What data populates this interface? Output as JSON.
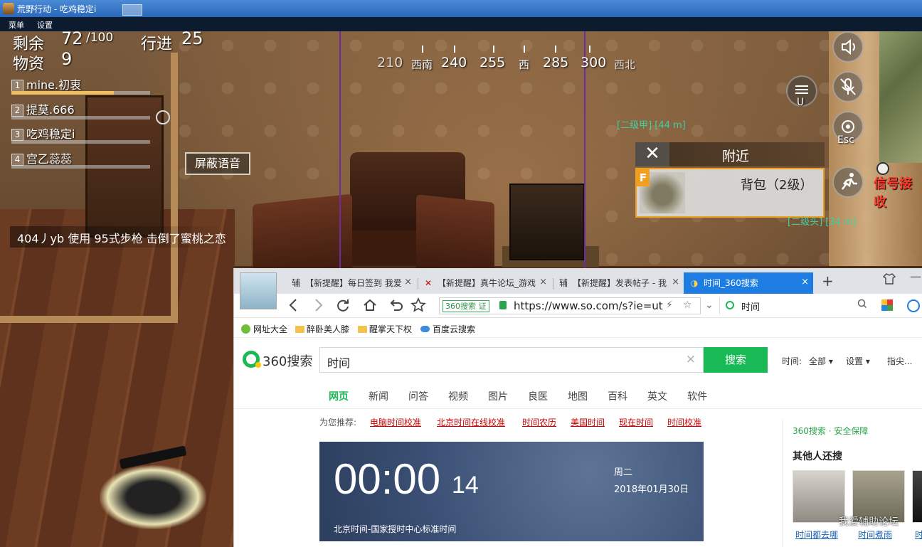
{
  "window": {
    "title": "荒野行动 - 吃鸡稳定i"
  },
  "menubar": {
    "items": [
      "菜单",
      "设置"
    ]
  },
  "hud": {
    "remaining_label": "剩余",
    "remaining_value": "72",
    "remaining_total": "/100",
    "travel_label": "行进",
    "travel_value": "25",
    "supplies_label": "物资",
    "supplies_value": "9",
    "team": [
      {
        "num": "1",
        "name": "mine.初衷",
        "hp": 0.74
      },
      {
        "num": "2",
        "name": "提莫.666",
        "hp": 0
      },
      {
        "num": "3",
        "name": "吃鸡稳定i",
        "hp": 0
      },
      {
        "num": "4",
        "name": "宫乙蕊蕊",
        "hp": 0
      }
    ],
    "mute_voice": "屏蔽语音",
    "kill_feed": "404丿yb 使用 95式步枪 击倒了蜜桃之恋"
  },
  "compass": [
    "210",
    "西南",
    "240",
    "255",
    "西",
    "285",
    "300",
    "西北"
  ],
  "controls": {
    "u_label": "U",
    "esc_label": "Esc"
  },
  "nearby": {
    "dist_top": "[二级甲] [44 m]",
    "dist_bottom": "[二级头] [34 m]",
    "title": "附近",
    "close": "✕",
    "item_key": "F",
    "item_name": "背包（2级）",
    "signal_text": "信号接收"
  },
  "browser": {
    "tabs": [
      {
        "fav": "辅",
        "title": "【新提醒】每日签到 我爱"
      },
      {
        "fav": "✕",
        "title": "【新提醒】真牛论坛_游戏"
      },
      {
        "fav": "辅",
        "title": "【新提醒】发表帖子 - 我"
      },
      {
        "fav": "◑",
        "title": "时间_360搜索"
      }
    ],
    "tab_close": "×",
    "new_tab": "+",
    "address": {
      "badge": "360搜索 证",
      "url": "https://www.so.com/s?ie=ut",
      "search_value": "时间"
    },
    "bookmarks": [
      "网址大全",
      "醉卧美人膝",
      "醒掌天下权",
      "百度云搜索"
    ],
    "page": {
      "logo": "360搜索",
      "query": "时间",
      "search_button": "搜索",
      "filter_time_label": "时间:",
      "filter_time_value": "全部 ▾",
      "filter_settings": "设置 ▾",
      "filter_more": "指尖...",
      "nav_tabs": [
        "网页",
        "新闻",
        "问答",
        "视频",
        "图片",
        "良医",
        "地图",
        "百科",
        "英文",
        "软件"
      ],
      "rec_label": "为您推荐:",
      "rec_links": [
        "电脑时间校准",
        "北京时间在线校准",
        "时间农历",
        "美国时间",
        "现在时间",
        "时间校准"
      ],
      "clock": {
        "time": "00:00",
        "seconds": "14",
        "weekday": "周二",
        "date": "2018年01月30日",
        "source": "北京时间-国家授时中心标准时间"
      },
      "safe": "360搜索 · 安全保障",
      "others_title": "其他人还搜",
      "thumbs": [
        "时间都去哪",
        "时间煮雨",
        "时"
      ],
      "watermark": "我爱辅助论坛"
    }
  }
}
